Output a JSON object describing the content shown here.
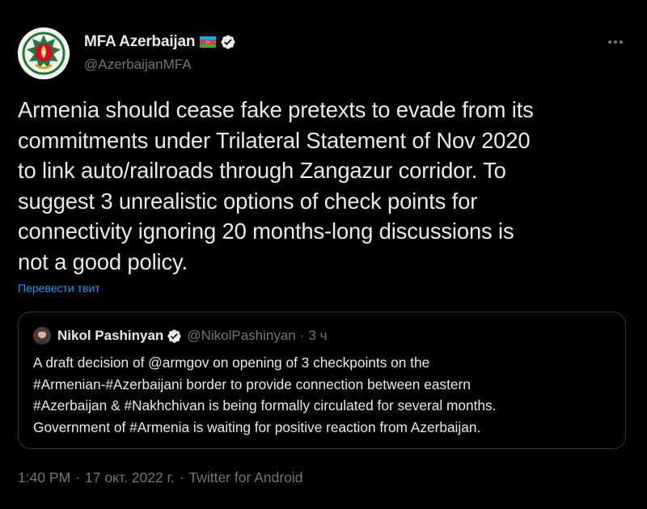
{
  "author": {
    "display_name": "MFA Azerbaijan",
    "handle": "@AzerbaijanMFA",
    "flag_icon": "azerbaijan-flag-icon",
    "verified": true
  },
  "tweet": {
    "text": "Armenia should cease fake pretexts to evade from its\ncommitments under Trilateral Statement of Nov 2020\nto link auto/railroads through Zangazur corridor. To\nsuggest 3 unrealistic options of check points for\nconnectivity ignoring 20 months-long discussions is\nnot a good policy.",
    "translate_label": "Перевести твит"
  },
  "quoted_tweet": {
    "display_name": "Nikol Pashinyan",
    "handle": "@NikolPashinyan",
    "separator": "·",
    "time": "3 ч",
    "verified": true,
    "text": "A draft decision of @armgov on opening of 3 checkpoints on the\n#Armenian-#Azerbaijani border to provide connection between eastern\n#Azerbaijan & #Nakhchivan is being formally circulated for several months.\nGovernment of #Armenia is waiting for positive reaction from Azerbaijan."
  },
  "meta": {
    "time": "1:40 PM",
    "dot1": "·",
    "date": "17 окт. 2022 г.",
    "dot2": "·",
    "source": "Twitter for Android"
  },
  "colors": {
    "background": "#000000",
    "text": "#e7e9ea",
    "secondary": "#71767b",
    "link": "#1d9bf0",
    "verified": "#1d9bf0"
  }
}
